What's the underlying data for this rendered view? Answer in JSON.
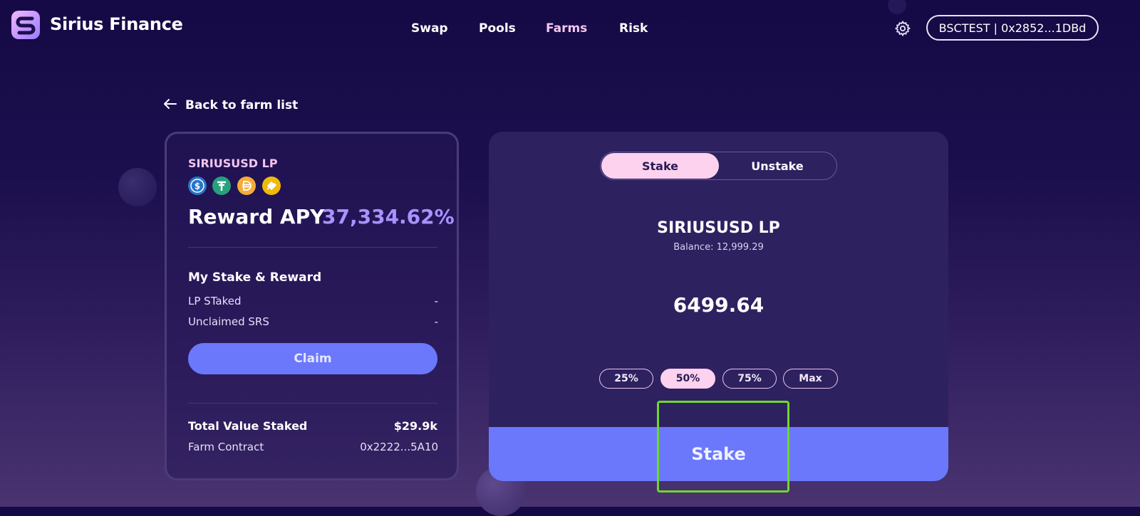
{
  "header": {
    "brand": "Sirius Finance",
    "nav": [
      {
        "label": "Swap"
      },
      {
        "label": "Pools"
      },
      {
        "label": "Farms",
        "active": true
      },
      {
        "label": "Risk"
      }
    ],
    "settings_icon": "gear-icon",
    "wallet": "BSCTEST | 0x2852...1DBd"
  },
  "back_link": "Back to farm list",
  "farm": {
    "name": "SIRIUSUSD LP",
    "coins": [
      "usdc-icon",
      "usdt-icon",
      "dai-icon",
      "busd-icon"
    ],
    "apy_label": "Reward APY",
    "apy_value": "37,334.62%",
    "my_stake_title": "My Stake & Reward",
    "lp_staked_label": "LP STaked",
    "lp_staked_value": "-",
    "unclaimed_label": "Unclaimed SRS",
    "unclaimed_value": "-",
    "claim_label": "Claim",
    "tvs_label": "Total Value Staked",
    "tvs_value": "$29.9k",
    "contract_label": "Farm Contract",
    "contract_value": "0x2222...5A10"
  },
  "stake_panel": {
    "tabs": [
      {
        "label": "Stake",
        "active": true
      },
      {
        "label": "Unstake"
      }
    ],
    "token": "SIRIUSUSD LP",
    "balance": "Balance: 12,999.29",
    "amount": "6499.64",
    "percent_buttons": [
      {
        "label": "25%"
      },
      {
        "label": "50%",
        "active": true
      },
      {
        "label": "75%"
      },
      {
        "label": "Max"
      }
    ],
    "stake_button": "Stake"
  },
  "colors": {
    "accent": "#6b78fb",
    "pink": "#fcd2ee",
    "apy": "#a892ff",
    "highlight": "#6ed82a"
  }
}
